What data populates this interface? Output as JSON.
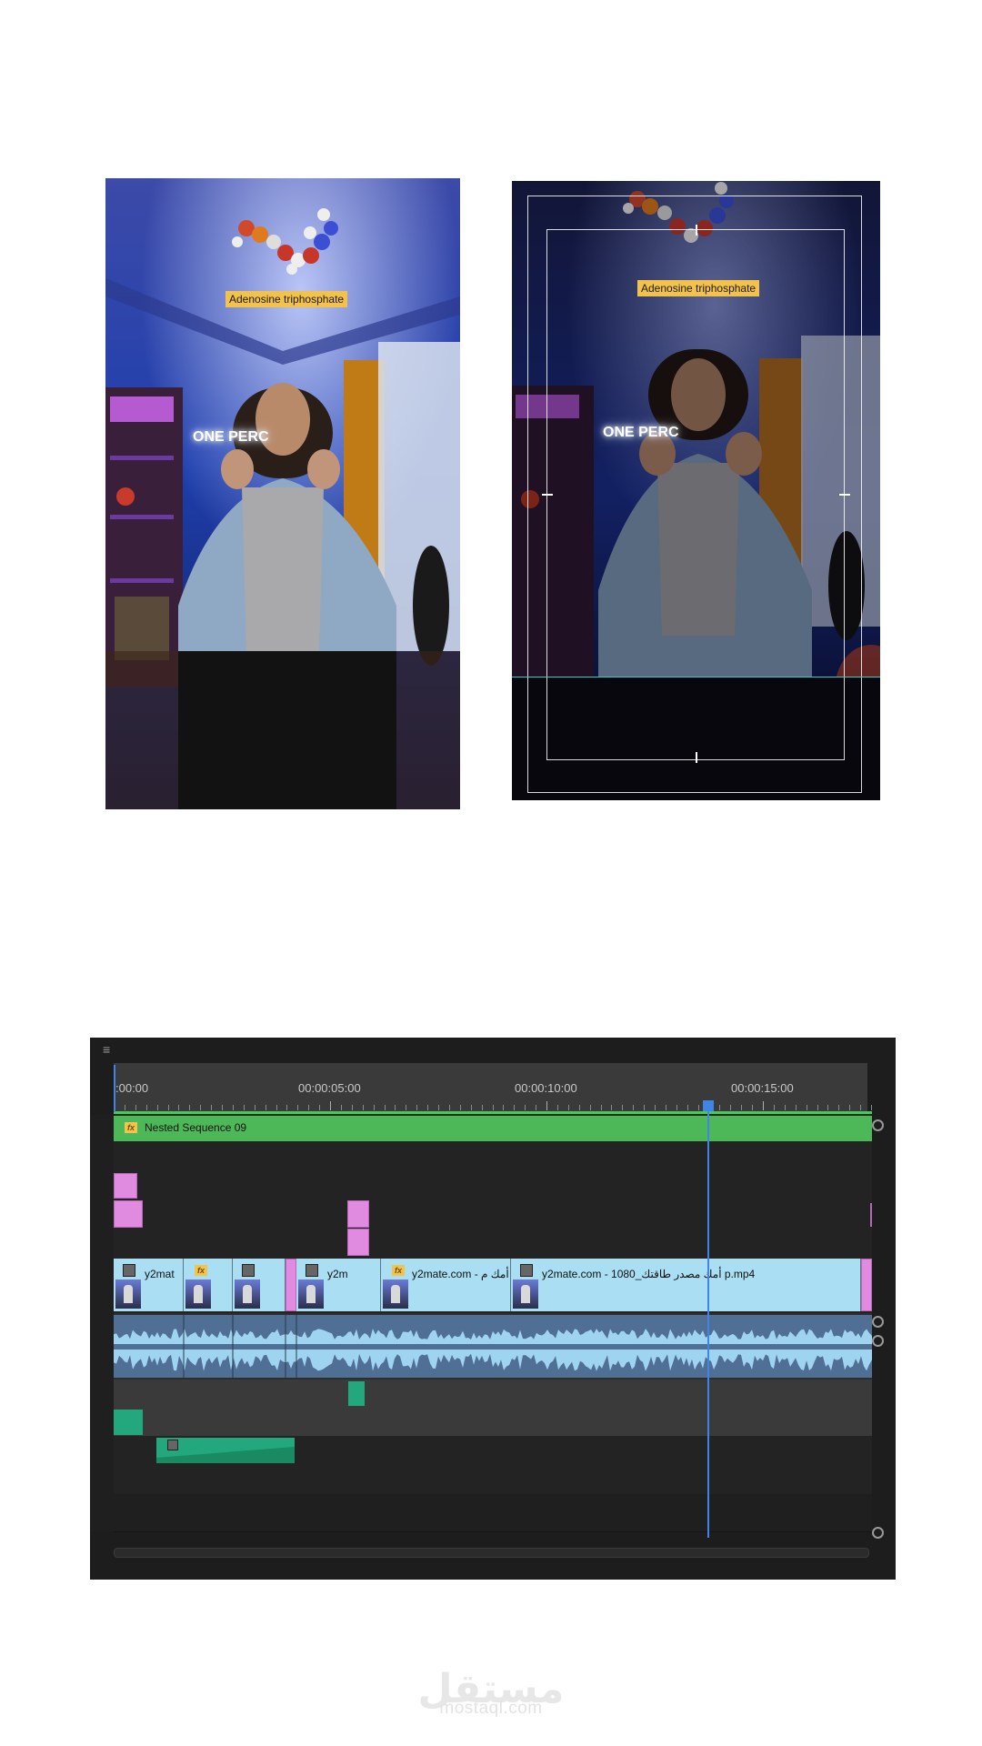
{
  "preview_left": {
    "label": "Adenosine triphosphate",
    "neon_sign": "ONE PERC"
  },
  "preview_right": {
    "label": "Adenosine triphosphate",
    "neon_sign": "ONE PERC"
  },
  "timeline": {
    "ruler": {
      "timecodes": [
        ":00:00",
        "00:00:05:00",
        "00:00:10:00",
        "00:00:15:00"
      ]
    },
    "nested_clip": {
      "name": "Nested Sequence 09",
      "fx": "fx"
    },
    "video_clips": [
      {
        "name": "y2mat",
        "fx": false
      },
      {
        "name": "",
        "fx": true
      },
      {
        "name": "",
        "fx": false
      },
      {
        "name": "y2m",
        "fx": false
      },
      {
        "name": "y2mate.com - أمك م",
        "fx": true
      },
      {
        "name": "y2mate.com - 1080_أمك مصدر طاقتك p.mp4",
        "fx": false
      }
    ],
    "colors": {
      "nested": "#4db858",
      "video": "#a9def3",
      "graphics": "#e08be0",
      "audio": "#4f6f95",
      "audio_fx": "#23a77c",
      "playhead": "#3f84e6",
      "ruler_bar": "#3fcf57"
    },
    "icons": [
      "menu-icon",
      "fx-badge",
      "clip-link-icon",
      "scroll-knob"
    ]
  },
  "watermark": {
    "arabic": "مستقل",
    "latin": "mostaql.com"
  }
}
